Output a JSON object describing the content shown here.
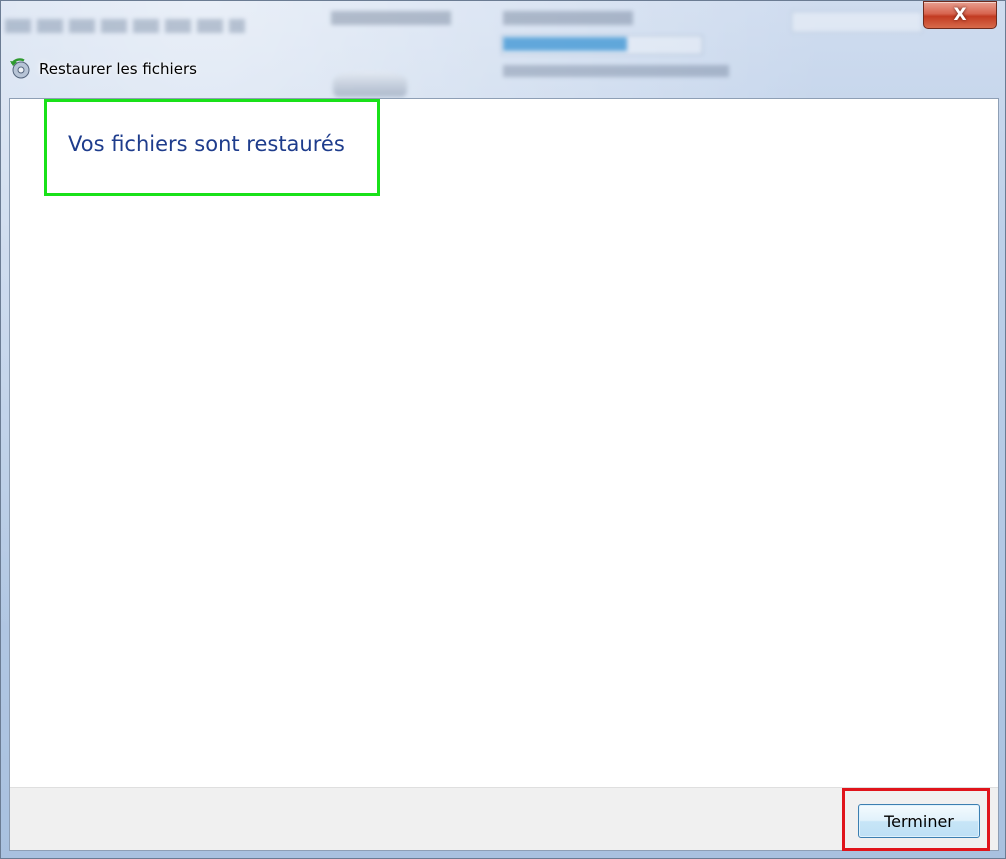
{
  "window": {
    "title": "Restaurer les fichiers",
    "close_glyph": "X"
  },
  "content": {
    "heading": "Vos fichiers sont restaurés"
  },
  "footer": {
    "finish_label": "Terminer"
  },
  "colors": {
    "heading": "#1e3c8c",
    "highlight_green": "#19e119",
    "highlight_red": "#e0141b",
    "close_button": "#c23b22"
  },
  "icons": {
    "app": "restore-files-icon",
    "close": "close-icon"
  }
}
